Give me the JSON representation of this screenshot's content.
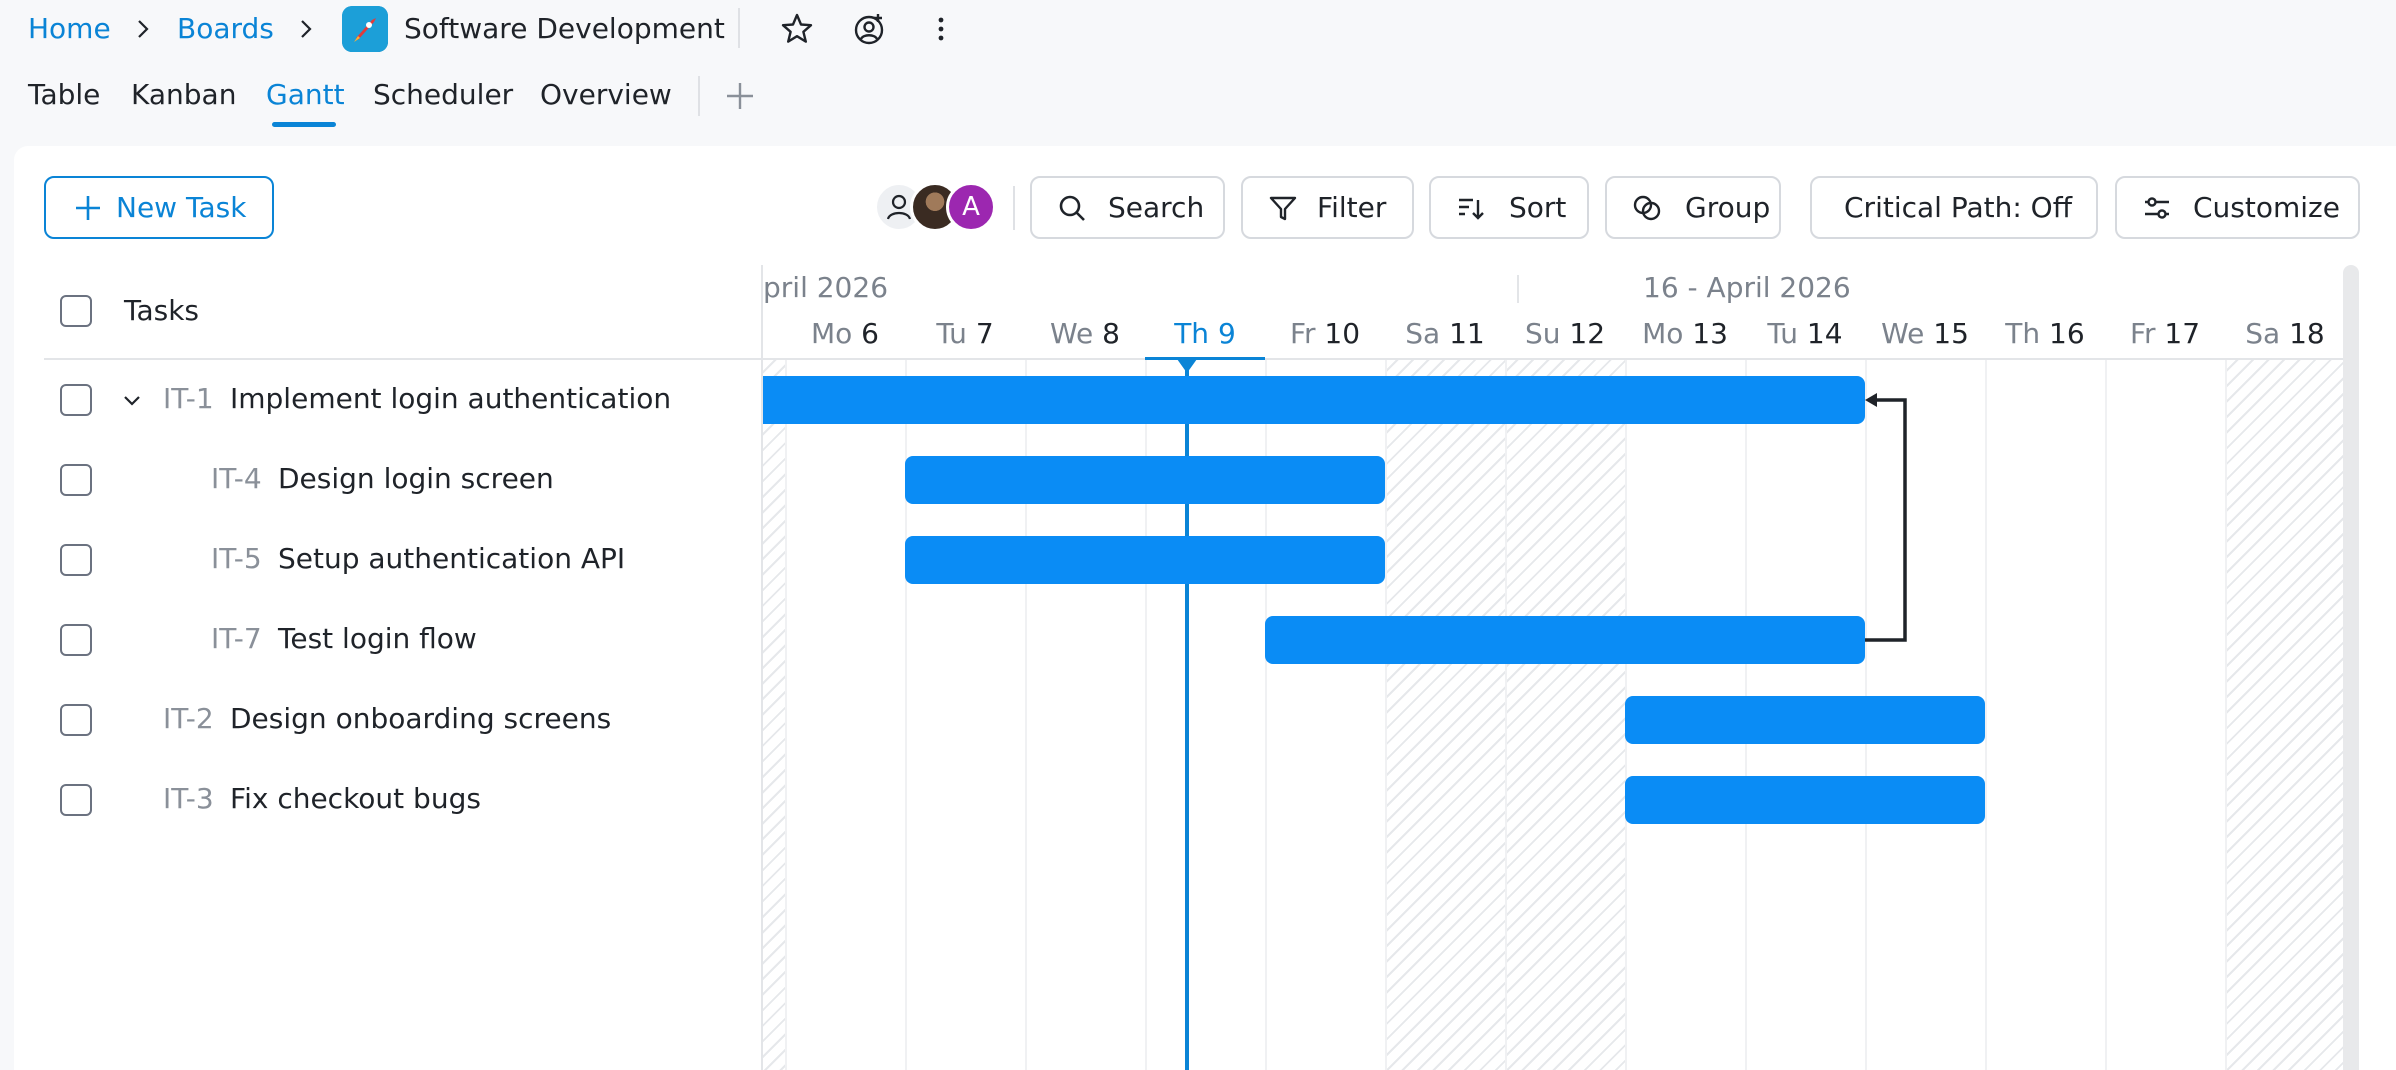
{
  "breadcrumb": {
    "home": "Home",
    "boards": "Boards",
    "board_title": "Software Development"
  },
  "tabs": [
    {
      "label": "Table",
      "active": false
    },
    {
      "label": "Kanban",
      "active": false
    },
    {
      "label": "Gantt",
      "active": true
    },
    {
      "label": "Scheduler",
      "active": false
    },
    {
      "label": "Overview",
      "active": false
    }
  ],
  "toolbar": {
    "new_task": "New Task",
    "search": "Search",
    "filter": "Filter",
    "sort": "Sort",
    "group": "Group",
    "critical_path": "Critical Path: Off",
    "customize": "Customize"
  },
  "avatars": [
    {
      "initial": ""
    },
    {
      "initial": ""
    },
    {
      "initial": "A",
      "color": "#9c27b0"
    }
  ],
  "grid": {
    "column_title": "Tasks"
  },
  "tasks": [
    {
      "key": "IT-1",
      "name": "Implement login authentication",
      "level": 0,
      "expanded": true,
      "start": "2026-04-05",
      "end": "2026-04-14"
    },
    {
      "key": "IT-4",
      "name": "Design login screen",
      "level": 1,
      "start": "2026-04-07",
      "end": "2026-04-10"
    },
    {
      "key": "IT-5",
      "name": "Setup authentication API",
      "level": 1,
      "start": "2026-04-07",
      "end": "2026-04-10"
    },
    {
      "key": "IT-7",
      "name": "Test login flow",
      "level": 1,
      "start": "2026-04-10",
      "end": "2026-04-14"
    },
    {
      "key": "IT-2",
      "name": "Design onboarding screens",
      "level": 0,
      "start": "2026-04-13",
      "end": "2026-04-15"
    },
    {
      "key": "IT-3",
      "name": "Fix checkout bugs",
      "level": 0,
      "start": "2026-04-13",
      "end": "2026-04-15"
    }
  ],
  "dependencies": [
    {
      "from": "IT-7",
      "to": "IT-1"
    }
  ],
  "timeline": {
    "weeks": [
      "pril 2026",
      "16 - April 2026"
    ],
    "days": [
      {
        "name": "Mo",
        "num": "6"
      },
      {
        "name": "Tu",
        "num": "7"
      },
      {
        "name": "We",
        "num": "8"
      },
      {
        "name": "Th",
        "num": "9",
        "today": true
      },
      {
        "name": "Fr",
        "num": "10"
      },
      {
        "name": "Sa",
        "num": "11",
        "weekend": true
      },
      {
        "name": "Su",
        "num": "12",
        "weekend": true
      },
      {
        "name": "Mo",
        "num": "13"
      },
      {
        "name": "Tu",
        "num": "14"
      },
      {
        "name": "We",
        "num": "15"
      },
      {
        "name": "Th",
        "num": "16"
      },
      {
        "name": "Fr",
        "num": "17"
      },
      {
        "name": "Sa",
        "num": "18",
        "weekend": true
      }
    ],
    "today": "2026-04-09"
  },
  "colors": {
    "accent": "#0a84d6",
    "bar": "#0a8cf5",
    "avatar_a": "#9c27b0"
  }
}
